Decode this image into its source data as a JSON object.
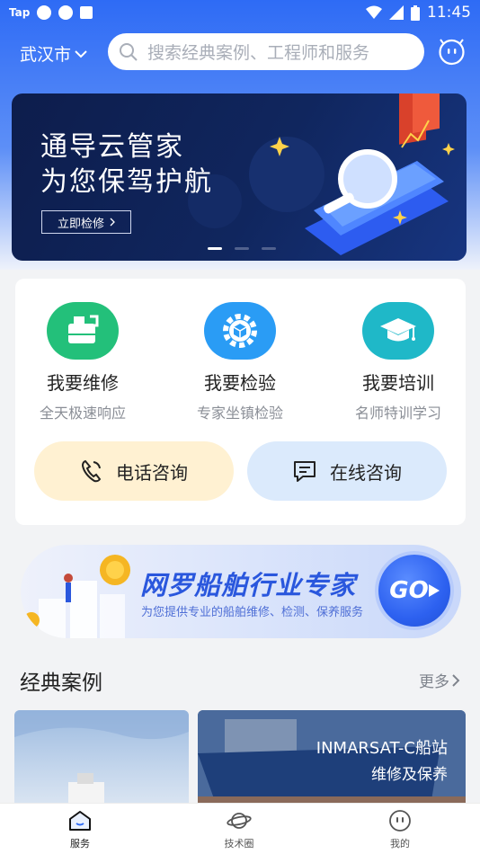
{
  "status_bar": {
    "carrier": "Tap",
    "time": "11:45"
  },
  "header": {
    "city": "武汉市",
    "search_placeholder": "搜索经典案例、工程师和服务"
  },
  "banner": {
    "line1": "通导云管家",
    "line2": "为您保驾护航",
    "button": "立即检修",
    "active_slide": 1,
    "slide_count": 3
  },
  "services": [
    {
      "name": "我要维修",
      "sub": "全天极速响应",
      "color": "#23c07a",
      "icon": "ship-wrench-icon"
    },
    {
      "name": "我要检验",
      "sub": "专家坐镇检验",
      "color": "#2a9cf5",
      "icon": "gear-cube-icon"
    },
    {
      "name": "我要培训",
      "sub": "名师特训学习",
      "color": "#1fb8c8",
      "icon": "graduation-cap-icon"
    }
  ],
  "consult": {
    "phone": "电话咨询",
    "online": "在线咨询",
    "phone_bg": "#fff1d2",
    "online_bg": "#dbeafc"
  },
  "promo": {
    "title": "网罗船舶行业专家",
    "sub": "为您提供专业的船舶维修、检测、保养服务",
    "go": "GO"
  },
  "cases": {
    "title": "经典案例",
    "more": "更多",
    "items": [
      {
        "line1": "",
        "line2": ""
      },
      {
        "line1": "INMARSAT-C船站",
        "line2": "维修及保养"
      }
    ]
  },
  "nav": {
    "items": [
      {
        "label": "服务",
        "icon": "home-icon",
        "active": true
      },
      {
        "label": "技术圈",
        "icon": "planet-icon",
        "active": false
      },
      {
        "label": "我的",
        "icon": "profile-face-icon",
        "active": false
      }
    ]
  },
  "colors": {
    "brand": "#2e6bf5",
    "promo_text": "#2a57dd"
  }
}
